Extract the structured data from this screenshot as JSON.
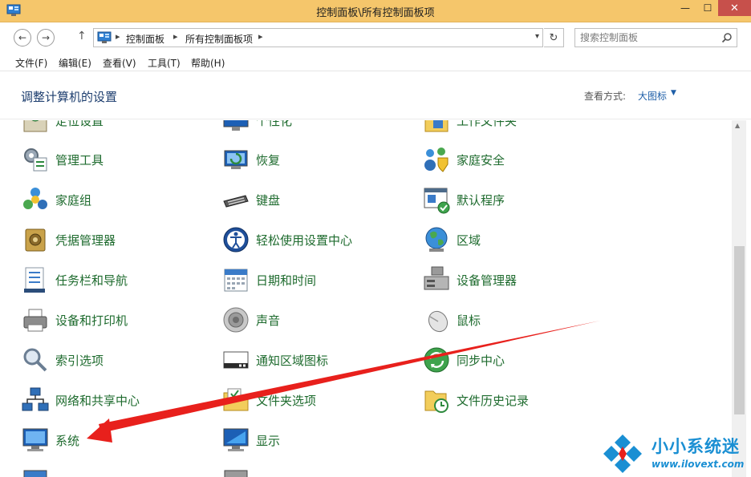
{
  "window": {
    "title": "控制面板\\所有控制面板项",
    "minimize_glyph": "—",
    "maximize_glyph": "☐",
    "close_glyph": "✕"
  },
  "address": {
    "back_glyph": "←",
    "forward_glyph": "→",
    "up_glyph": "↑",
    "breadcrumb": [
      "控制面板",
      "所有控制面板项"
    ],
    "separator": "▸",
    "dropdown_glyph": "▾",
    "refresh_glyph": "↻"
  },
  "search": {
    "placeholder": "搜索控制面板"
  },
  "menu": [
    "文件(F)",
    "编辑(E)",
    "查看(V)",
    "工具(T)",
    "帮助(H)"
  ],
  "header": {
    "title": "调整计算机的设置",
    "view_label": "查看方式:",
    "view_value": "大图标",
    "view_caret": "▼"
  },
  "columns": [
    {
      "items": [
        {
          "label": "定位设置",
          "icon": "location-icon"
        },
        {
          "label": "管理工具",
          "icon": "admin-tools-icon"
        },
        {
          "label": "家庭组",
          "icon": "homegroup-icon"
        },
        {
          "label": "凭据管理器",
          "icon": "credential-icon"
        },
        {
          "label": "任务栏和导航",
          "icon": "taskbar-icon"
        },
        {
          "label": "设备和打印机",
          "icon": "printer-icon"
        },
        {
          "label": "索引选项",
          "icon": "indexing-icon"
        },
        {
          "label": "网络和共享中心",
          "icon": "network-icon"
        },
        {
          "label": "系统",
          "icon": "system-icon"
        }
      ]
    },
    {
      "items": [
        {
          "label": "个性化",
          "icon": "personalization-icon"
        },
        {
          "label": "恢复",
          "icon": "recovery-icon"
        },
        {
          "label": "键盘",
          "icon": "keyboard-icon"
        },
        {
          "label": "轻松使用设置中心",
          "icon": "ease-of-access-icon"
        },
        {
          "label": "日期和时间",
          "icon": "calendar-icon"
        },
        {
          "label": "声音",
          "icon": "speaker-icon"
        },
        {
          "label": "通知区域图标",
          "icon": "notification-icon"
        },
        {
          "label": "文件夹选项",
          "icon": "folder-options-icon"
        },
        {
          "label": "显示",
          "icon": "display-icon"
        }
      ]
    },
    {
      "items": [
        {
          "label": "工作文件夹",
          "icon": "work-folders-icon"
        },
        {
          "label": "家庭安全",
          "icon": "family-safety-icon"
        },
        {
          "label": "默认程序",
          "icon": "default-programs-icon"
        },
        {
          "label": "区域",
          "icon": "region-icon"
        },
        {
          "label": "设备管理器",
          "icon": "device-manager-icon"
        },
        {
          "label": "鼠标",
          "icon": "mouse-icon"
        },
        {
          "label": "同步中心",
          "icon": "sync-icon"
        },
        {
          "label": "文件历史记录",
          "icon": "file-history-icon"
        }
      ]
    }
  ],
  "watermark": {
    "name": "小小系统迷",
    "url": "www.ilovext.com"
  },
  "colors": {
    "titlebar": "#f5c66b",
    "item_label": "#1e6b2e",
    "header_title": "#1c3d6e",
    "link": "#1d5ea8",
    "annotation_arrow": "#e8201c",
    "watermark": "#1a8fd3"
  }
}
